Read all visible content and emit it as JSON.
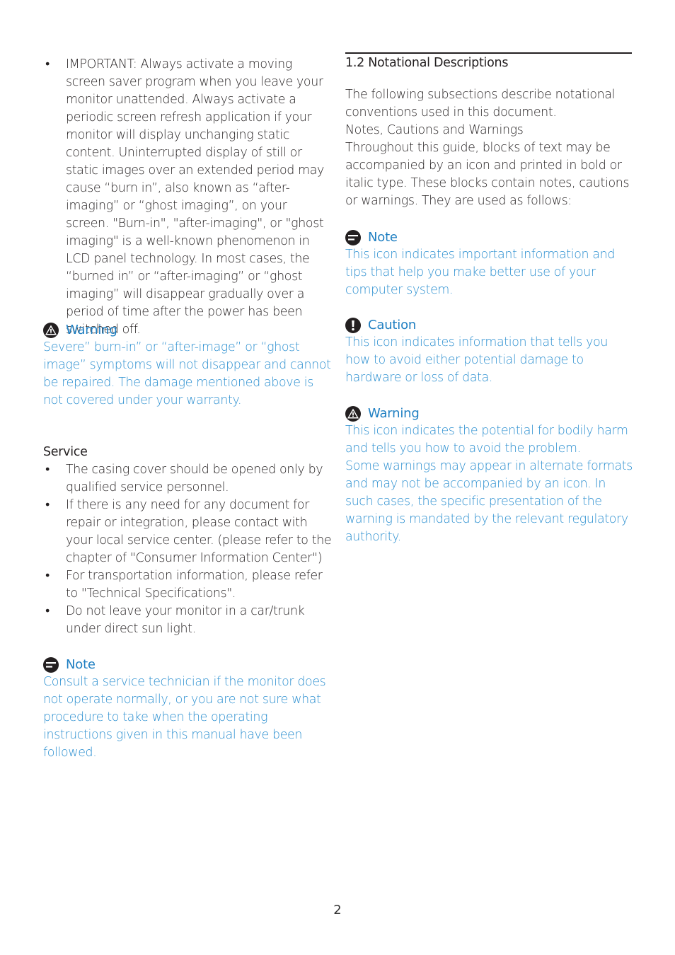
{
  "left": {
    "important_bullet": "IMPORTANT: Always activate a moving screen saver program when you leave your monitor unattended. Always activate a periodic screen refresh application if your monitor will display unchanging static content. Uninterrupted display of still or static images over an extended period may cause “burn in”, also known as “after-imaging” or “ghost imaging”, on your screen. \"Burn-in\", \"after-imaging\", or \"ghost imaging\" is a well-known phenomenon in LCD panel technology. In most cases, the “burned in” or “after-imaging” or “ghost imaging” will disappear gradually over a period of time after the power has been switched off.",
    "warning": {
      "icon": "warning-triangle-icon",
      "title": "Warning",
      "body": "Severe” burn-in” or “after-image” or “ghost image” symptoms will not disappear and cannot be repaired. The damage mentioned above is not covered under your warranty."
    },
    "service": {
      "heading": "Service",
      "items": [
        "The casing cover should be opened only by qualified service personnel.",
        "If there is any need for any document for repair or integration, please contact with your local service center. (please refer to the chapter of \"Consumer Information Center\")",
        "For transportation information, please refer to \"Technical Specifications\".",
        "Do not leave your monitor in a car/trunk under direct sun light."
      ]
    },
    "note": {
      "icon": "note-icon",
      "title": "Note",
      "body": "Consult a service technician if the monitor does not operate normally, or you are not sure what procedure to take when the operating instructions given in this manual have been followed."
    }
  },
  "right": {
    "section_title": "1.2 Notational Descriptions",
    "intro": "The following subsections describe notational conventions used in this document.",
    "subheading": "Notes, Cautions and Warnings",
    "description": "Throughout this guide, blocks of text may be accompanied by an icon and printed in bold or italic type. These blocks contain notes, cautions or warnings. They are used as follows:",
    "note": {
      "icon": "note-icon",
      "title": "Note",
      "body": "This icon indicates important information and tips that help you make better use of your computer system."
    },
    "caution": {
      "icon": "caution-exclamation-icon",
      "title": "Caution",
      "body": "This icon indicates information that tells you how to avoid either potential damage to hardware or loss of data."
    },
    "warning": {
      "icon": "warning-triangle-icon",
      "title": "Warning",
      "body": "This icon indicates the potential for bodily harm and tells you how to avoid the problem.",
      "body2": "Some warnings may appear in alternate formats and may not be accompanied by an icon. In such cases, the specific presentation of the warning is mandated by the relevant regulatory authority."
    }
  },
  "footer": {
    "page_number": "2"
  },
  "colors": {
    "accent_blue": "#2b8fd0",
    "heading_blue": "#1f7fc2",
    "text": "#231f20"
  }
}
